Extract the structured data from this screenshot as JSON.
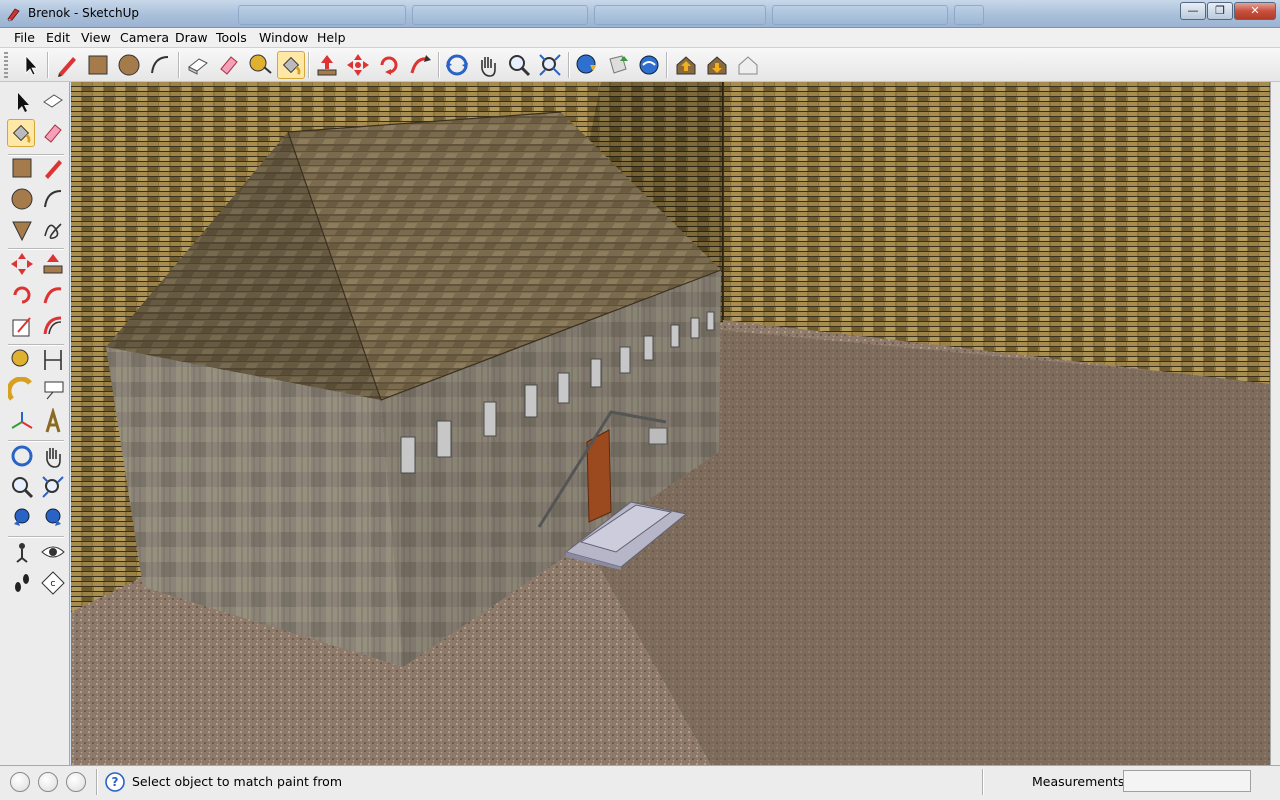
{
  "window": {
    "title": "Brenok - SketchUp",
    "controls": {
      "minimize": "—",
      "maximize": "❐",
      "close": "✕"
    }
  },
  "menu": {
    "items": [
      "File",
      "Edit",
      "View",
      "Camera",
      "Draw",
      "Tools",
      "Window",
      "Help"
    ]
  },
  "toolbar": {
    "active_tool": "paint-bucket",
    "buttons": [
      "select",
      "pencil",
      "rectangle",
      "circle",
      "arc",
      "make-component",
      "eraser",
      "tape-measure",
      "paint-bucket",
      "push-pull",
      "move",
      "rotate",
      "follow-me",
      "orbit",
      "pan",
      "zoom",
      "zoom-extents",
      "get-models",
      "share-model",
      "google-earth",
      "import-model",
      "export-model",
      "photo-textures"
    ]
  },
  "palette": {
    "active_tool": "paint-bucket",
    "buttons": [
      "select",
      "make-component",
      "paint-bucket",
      "eraser",
      "rectangle",
      "line",
      "circle",
      "arc",
      "polygon",
      "freehand",
      "move",
      "push-pull",
      "rotate",
      "follow-me",
      "scale",
      "offset",
      "tape-measure",
      "dimensions",
      "protractor",
      "text",
      "axes",
      "3d-text",
      "orbit",
      "pan",
      "zoom",
      "zoom-window",
      "previous-view",
      "zoom-extents",
      "position-camera",
      "look-around",
      "walk",
      "section-plane"
    ]
  },
  "scene": {
    "colors": {
      "brick": "#8a7440",
      "floor": "#8e7a6a",
      "roof": "#7a6a4e",
      "wall": "#8c8478",
      "door": "#9a4a1e",
      "steps": "#b6b6c8"
    }
  },
  "status": {
    "hint": "Select object to match paint from",
    "measurements_label": "Measurements",
    "measurements_value": ""
  }
}
